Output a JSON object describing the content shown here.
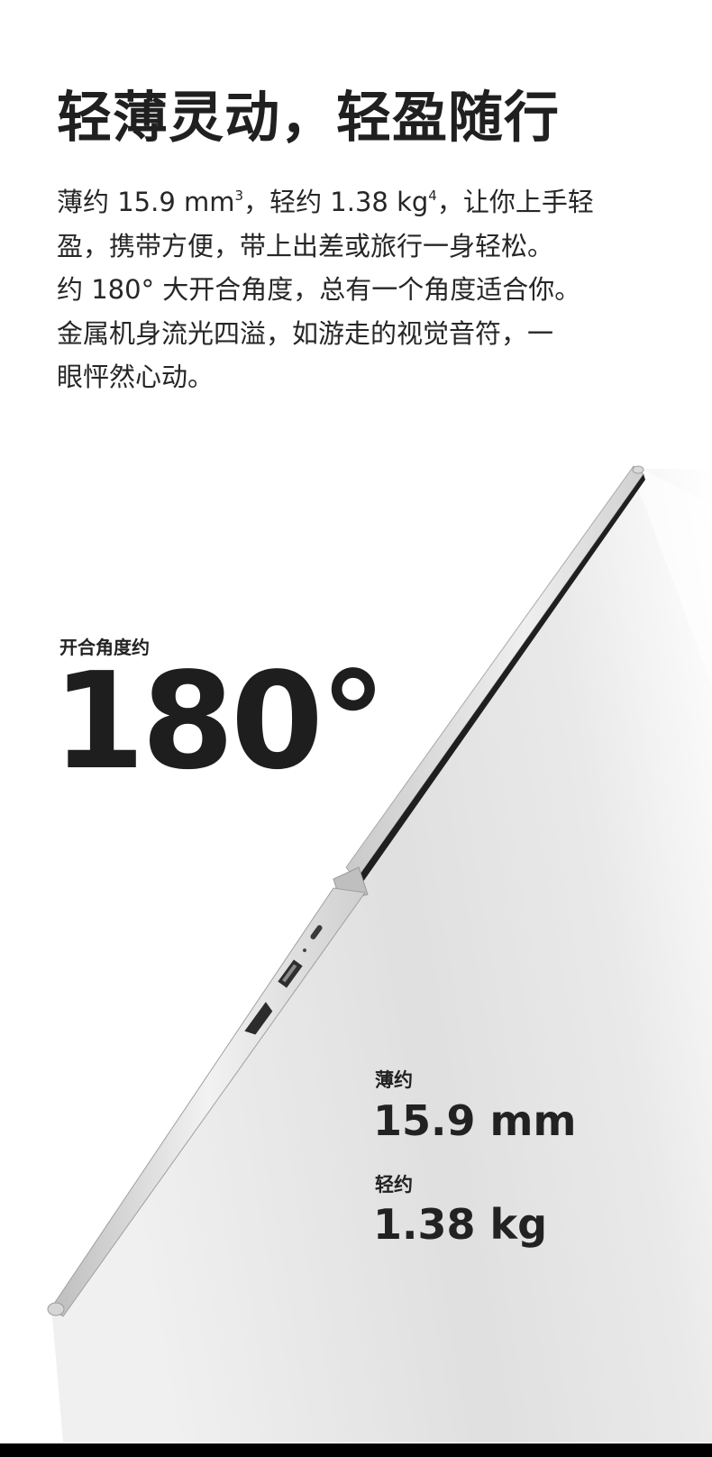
{
  "headline": "轻薄灵动，轻盈随行",
  "body": {
    "line1_prefix": "薄约 15.9 mm",
    "line1_sup1": "3",
    "line1_mid": "，轻约 1.38 kg",
    "line1_sup2": "4",
    "line1_suffix": "，让你上手轻",
    "line2": "盈，携带方便，带上出差或旅行一身轻松。",
    "line3": "约 180° 大开合角度，总有一个角度适合你。",
    "line4": "金属机身流光四溢，如游走的视觉音符，一",
    "line5": "眼怦然心动。"
  },
  "angle": {
    "label": "开合角度约",
    "value": "180°"
  },
  "specs": {
    "thickness_label": "薄约",
    "thickness_value": "15.9 mm",
    "weight_label": "轻约",
    "weight_value": "1.38 kg"
  }
}
